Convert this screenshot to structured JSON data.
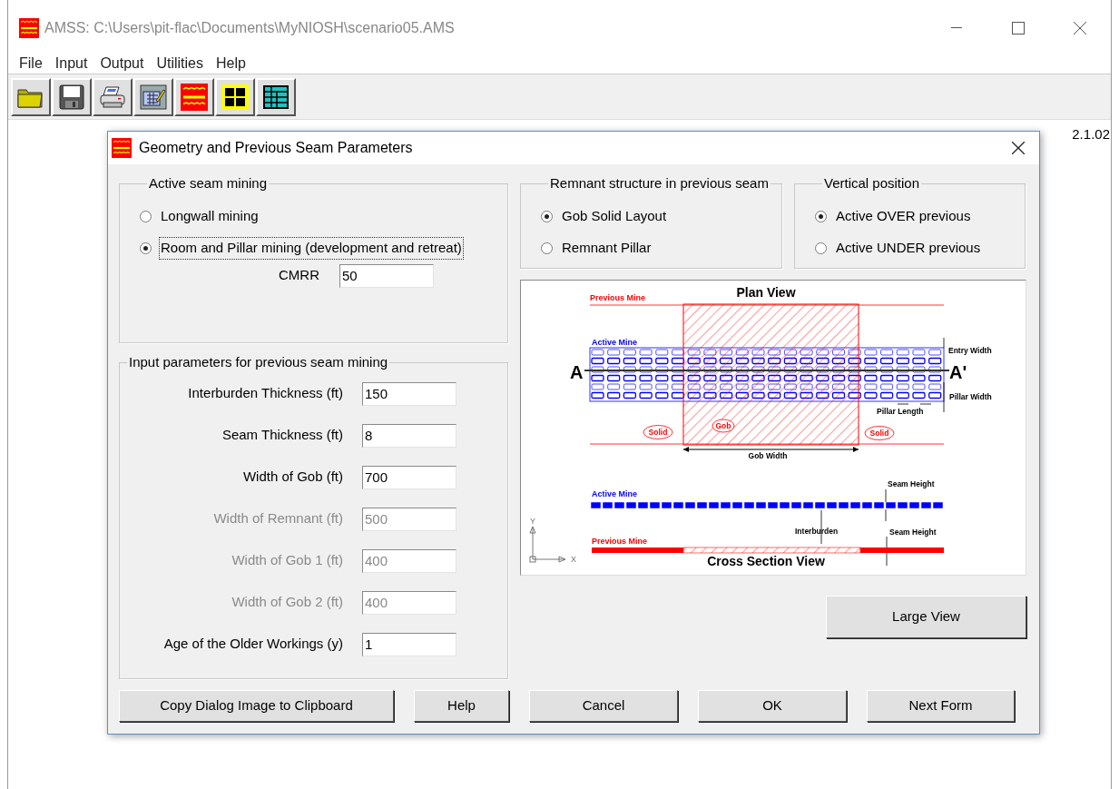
{
  "window": {
    "title": "AMSS: C:\\Users\\pit-flac\\Documents\\MyNIOSH\\scenario05.AMS"
  },
  "menu": [
    "File",
    "Input",
    "Output",
    "Utilities",
    "Help"
  ],
  "toolbar": [
    {
      "kind": "open"
    },
    {
      "kind": "save"
    },
    {
      "kind": "print"
    },
    {
      "kind": "edit"
    },
    {
      "kind": "seam"
    },
    {
      "kind": "grid"
    },
    {
      "kind": "table"
    }
  ],
  "version": "2.1.02",
  "dialog": {
    "title": "Geometry and Previous Seam Parameters",
    "active_seam": {
      "title": "Active seam mining",
      "options": [
        {
          "label": "Longwall mining",
          "selected": false,
          "focused": false
        },
        {
          "label": "Room and Pillar mining (development and retreat)",
          "selected": true,
          "focused": true
        }
      ],
      "cmrr": {
        "label": "CMRR",
        "value": "50"
      }
    },
    "remnant": {
      "title": "Remnant structure in previous seam",
      "options": [
        {
          "label": "Gob Solid Layout",
          "selected": true
        },
        {
          "label": "Remnant Pillar",
          "selected": false
        }
      ]
    },
    "vertical": {
      "title": "Vertical position",
      "options": [
        {
          "label": "Active OVER previous",
          "selected": true
        },
        {
          "label": "Active UNDER previous",
          "selected": false
        }
      ]
    },
    "previous_seam": {
      "title": "Input parameters for previous seam mining",
      "fields": [
        {
          "label": "Interburden Thickness (ft)",
          "value": "150",
          "disabled": false
        },
        {
          "label": "Seam Thickness (ft)",
          "value": "8",
          "disabled": false
        },
        {
          "label": "Width of Gob (ft)",
          "value": "700",
          "disabled": false
        },
        {
          "label": "Width of Remnant (ft)",
          "value": "500",
          "disabled": true
        },
        {
          "label": "Width of Gob 1 (ft)",
          "value": "400",
          "disabled": true
        },
        {
          "label": "Width of Gob 2 (ft)",
          "value": "400",
          "disabled": true
        },
        {
          "label": "Age of the Older Workings (y)",
          "value": "1",
          "disabled": false
        }
      ]
    },
    "diagram": {
      "plan_title": "Plan View",
      "previous_mine": "Previous Mine",
      "active_mine": "Active Mine",
      "section_start": "A",
      "section_end": "A'",
      "entry_width": "Entry Width",
      "pillar_width": "Pillar Width",
      "pillar_length": "Pillar Length",
      "solid_labels": [
        "Solid",
        "Solid"
      ],
      "gob": "Gob",
      "gob_width": "Gob Width",
      "cross_active_mine": "Active Mine",
      "cross_previous_mine": "Previous Mine",
      "seam_heights": [
        "Seam Height",
        "Seam Height"
      ],
      "interburden": "Interburden",
      "cross_title": "Cross Section View",
      "axis_y": "Y",
      "axis_x": "X"
    },
    "large_view_button": "Large View",
    "buttons": [
      "Copy Dialog Image to Clipboard",
      "Help",
      "Cancel",
      "OK",
      "Next Form"
    ]
  }
}
